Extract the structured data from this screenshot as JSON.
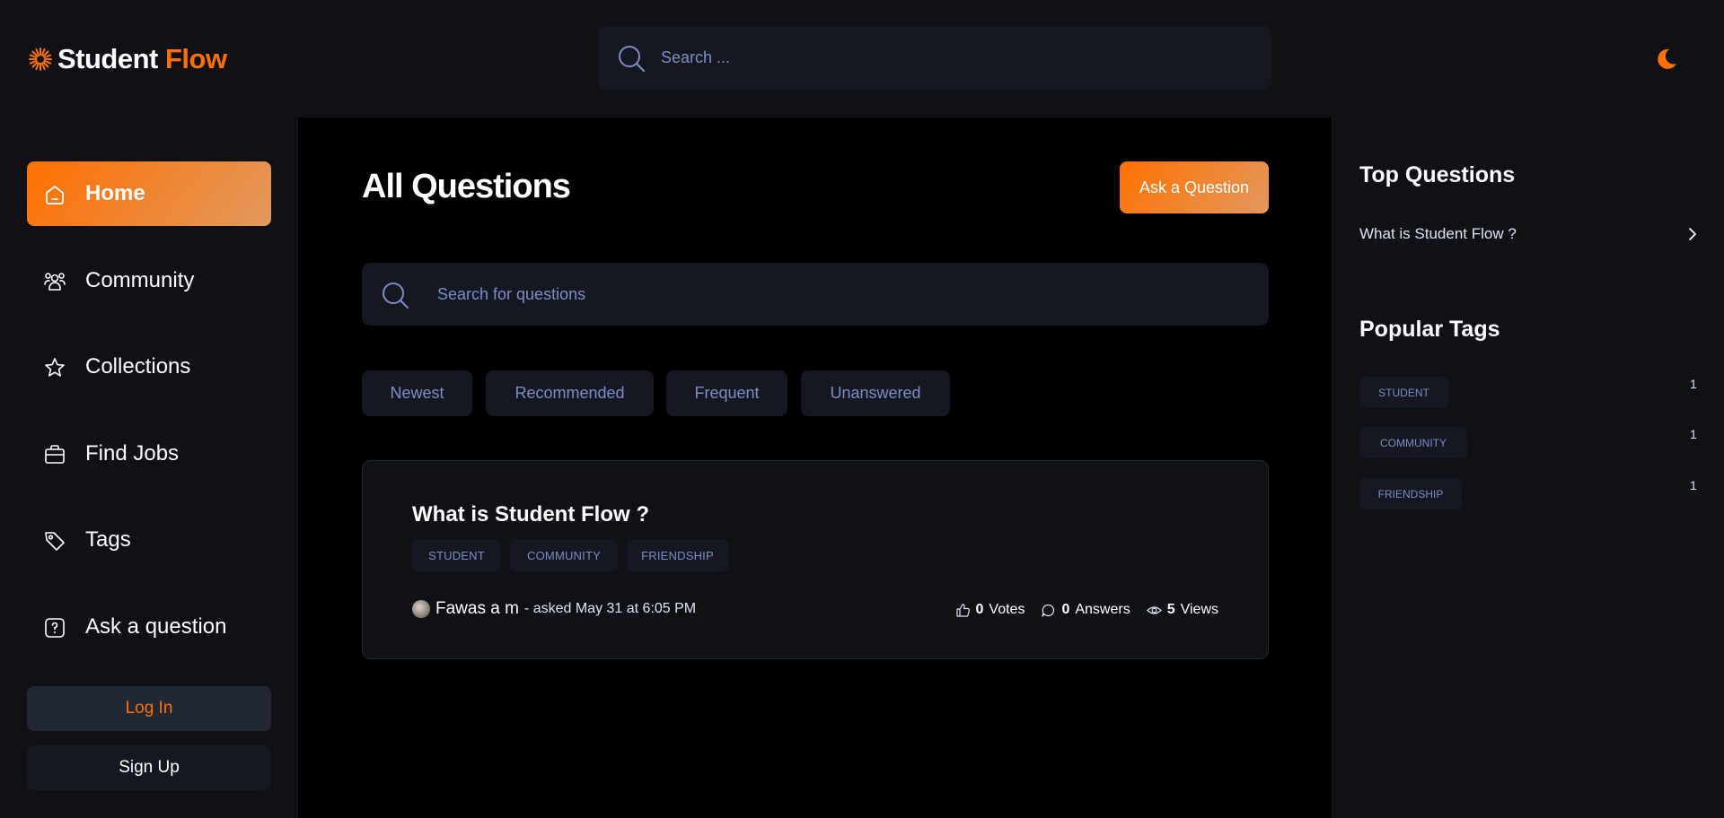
{
  "navbar": {
    "logo_word1": "Student",
    "logo_word2": "Flow",
    "search_placeholder": "Search ...",
    "theme_icon": "moon-icon"
  },
  "colors": {
    "accent": "#ff7000",
    "accent_gradient_end": "#e2995f",
    "panel_bg": "#0f1117",
    "field_bg": "#151821",
    "muted_text": "#7b8ec8"
  },
  "sidebar": {
    "items": [
      {
        "label": "Home",
        "icon": "home-icon",
        "active": true
      },
      {
        "label": "Community",
        "icon": "community-icon",
        "active": false
      },
      {
        "label": "Collections",
        "icon": "star-icon",
        "active": false
      },
      {
        "label": "Find Jobs",
        "icon": "briefcase-icon",
        "active": false
      },
      {
        "label": "Tags",
        "icon": "tag-icon",
        "active": false
      },
      {
        "label": "Ask a question",
        "icon": "question-icon",
        "active": false
      }
    ],
    "login_label": "Log In",
    "signup_label": "Sign Up"
  },
  "main": {
    "title": "All Questions",
    "ask_button": "Ask a Question",
    "search_placeholder": "Search for questions",
    "filters": [
      "Newest",
      "Recommended",
      "Frequent",
      "Unanswered"
    ],
    "questions": [
      {
        "title": "What is Student Flow ?",
        "tags": [
          "STUDENT",
          "COMMUNITY",
          "FRIENDSHIP"
        ],
        "author": "Fawas a m",
        "asked": "- asked May 31 at 6:05 PM",
        "votes_value": "0",
        "votes_label": "Votes",
        "answers_value": "0",
        "answers_label": "Answers",
        "views_value": "5",
        "views_label": "Views"
      }
    ]
  },
  "rightbar": {
    "top_questions_heading": "Top Questions",
    "top_questions": [
      "What is Student Flow ?"
    ],
    "popular_tags_heading": "Popular Tags",
    "popular_tags": [
      {
        "name": "STUDENT",
        "count": "1"
      },
      {
        "name": "COMMUNITY",
        "count": "1"
      },
      {
        "name": "FRIENDSHIP",
        "count": "1"
      }
    ]
  }
}
